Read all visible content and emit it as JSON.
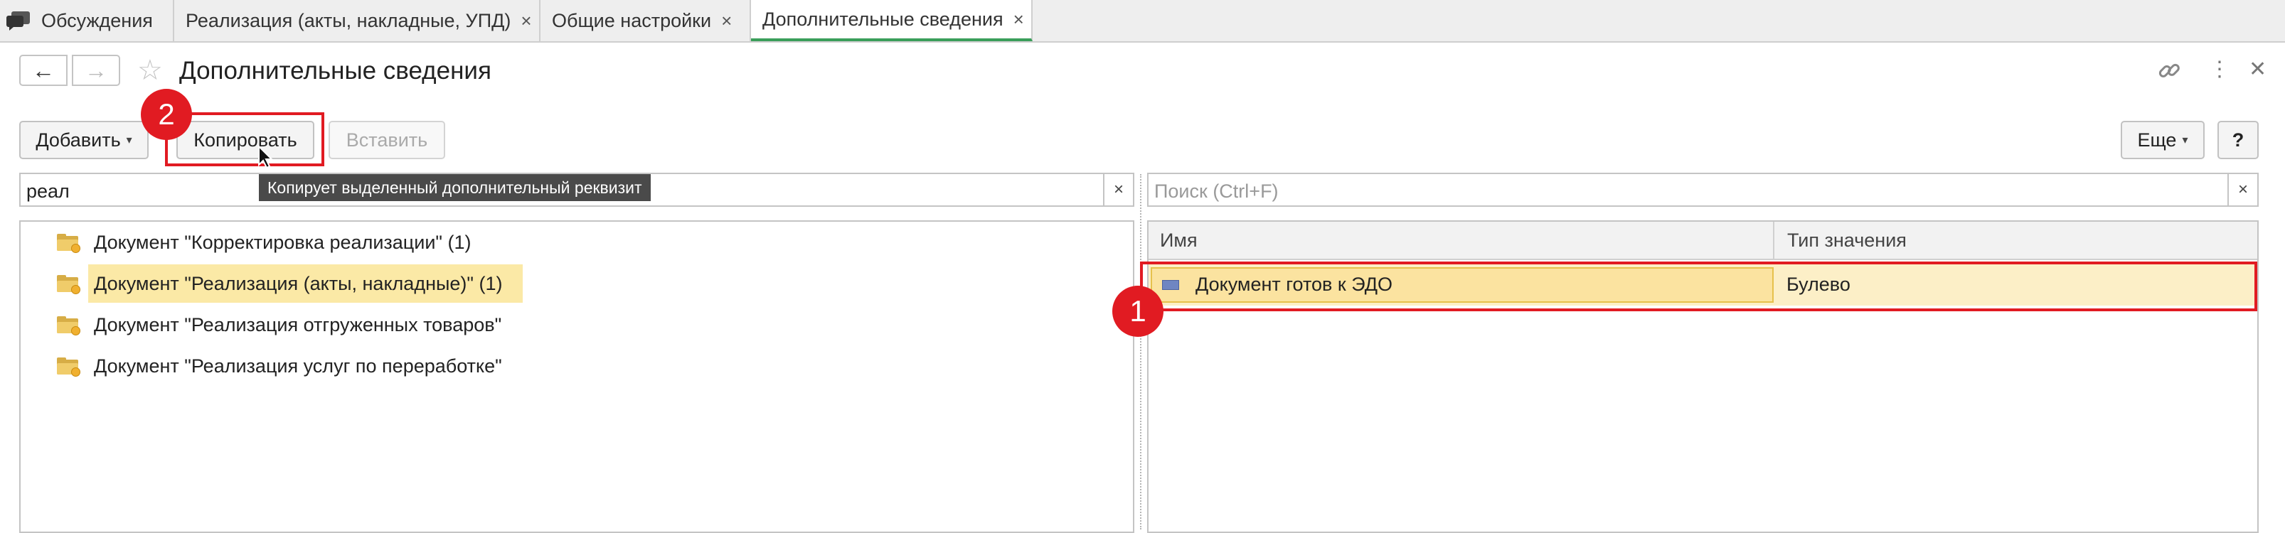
{
  "tabs": [
    {
      "label": "Обсуждения",
      "icon": "chat-icon"
    },
    {
      "label": "Реализация (акты, накладные, УПД)",
      "close": "×"
    },
    {
      "label": "Общие настройки",
      "close": "×"
    },
    {
      "label": "Дополнительные сведения",
      "close": "×",
      "active": true
    }
  ],
  "header": {
    "back": "←",
    "forward": "→",
    "star": "☆",
    "title": "Дополнительные сведения",
    "link_icon": "🔗",
    "more_icon": "⋮",
    "close_icon": "✕"
  },
  "toolbar": {
    "add_label": "Добавить",
    "caret": "▾",
    "copy_label": "Копировать",
    "paste_label": "Вставить",
    "more_label": "Еще",
    "help_label": "?"
  },
  "left_search": {
    "value": "реал",
    "clear": "×"
  },
  "right_search": {
    "placeholder": "Поиск (Ctrl+F)",
    "clear": "×"
  },
  "tooltip": "Копирует выделенный дополнительный реквизит",
  "left_list": [
    "Документ \"Корректировка реализации\" (1)",
    "Документ \"Реализация (акты, накладные)\" (1)",
    "Документ \"Реализация отгруженных товаров\"",
    "Документ \"Реализация услуг по переработке\""
  ],
  "grid": {
    "columns": [
      "Имя",
      "Тип значения"
    ],
    "rows": [
      {
        "name": "Документ готов к ЭДО",
        "type": "Булево"
      }
    ]
  },
  "annotations": {
    "badge1": "1",
    "badge2": "2",
    "color": "#e11b22"
  },
  "colors": {
    "accent": "#3a9e5a",
    "selection": "#fbe9a6",
    "folder": "#f0cc6a"
  }
}
